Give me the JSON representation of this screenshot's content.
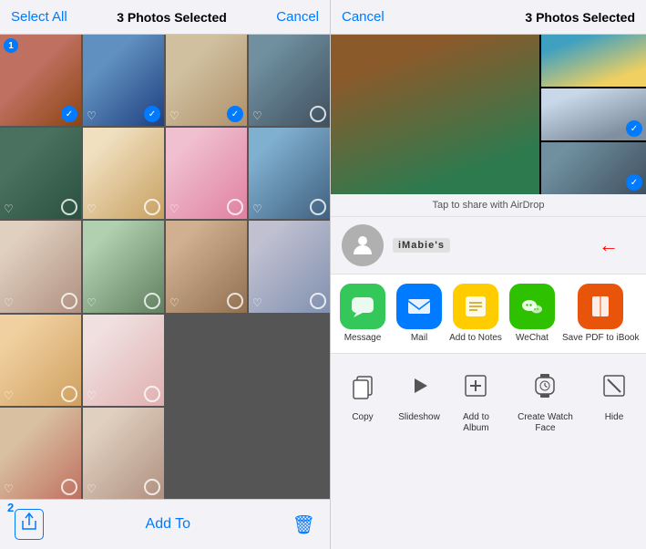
{
  "left": {
    "toolbar": {
      "select_all": "Select All",
      "title": "3 Photos Selected",
      "cancel": "Cancel"
    },
    "bottom": {
      "badge": "2",
      "add_to": "Add To"
    }
  },
  "right": {
    "toolbar": {
      "cancel": "Cancel",
      "title": "3 Photos Selected"
    },
    "airdrop_hint": "Tap to share with AirDrop",
    "contact": {
      "name": "iMabie's"
    },
    "share_actions": [
      {
        "label": "Message",
        "icon": "💬",
        "color_class": "icon-message"
      },
      {
        "label": "Mail",
        "icon": "✉️",
        "color_class": "icon-mail"
      },
      {
        "label": "Add to Notes",
        "icon": "📝",
        "color_class": "icon-notes"
      },
      {
        "label": "WeChat",
        "icon": "💬",
        "color_class": "icon-wechat"
      },
      {
        "label": "Save PDF\nto iBook",
        "icon": "📖",
        "color_class": "icon-ibook"
      }
    ],
    "file_actions": [
      {
        "label": "Copy",
        "icon": "⎘"
      },
      {
        "label": "Slideshow",
        "icon": "▶"
      },
      {
        "label": "Add to Album",
        "icon": "➕"
      },
      {
        "label": "Create\nWatch Face",
        "icon": "⌚"
      },
      {
        "label": "Hide",
        "icon": "⊘"
      }
    ]
  }
}
